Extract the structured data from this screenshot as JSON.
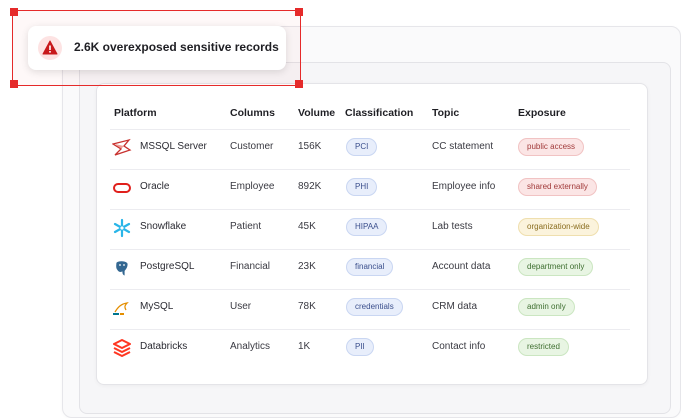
{
  "alert": {
    "message": "2.6K overexposed sensitive records",
    "icon": "warning-triangle-icon",
    "color": "#e52a2a"
  },
  "table": {
    "headers": [
      "Platform",
      "Columns",
      "Volume",
      "Classification",
      "Topic",
      "Exposure"
    ],
    "rows": [
      {
        "platform": "MSSQL Server",
        "logo": "mssql-server-logo-icon",
        "columns": "Customer",
        "volume": "156K",
        "classification": "PCI",
        "topic": "CC statement",
        "exposure": "public access",
        "exposure_level": "red"
      },
      {
        "platform": "Oracle",
        "logo": "oracle-logo-icon",
        "columns": "Employee",
        "volume": "892K",
        "classification": "PHI",
        "topic": "Employee info",
        "exposure": "shared externally",
        "exposure_level": "red"
      },
      {
        "platform": "Snowflake",
        "logo": "snowflake-logo-icon",
        "columns": "Patient",
        "volume": "45K",
        "classification": "HIPAA",
        "topic": "Lab tests",
        "exposure": "organization-wide",
        "exposure_level": "yellow"
      },
      {
        "platform": "PostgreSQL",
        "logo": "postgresql-logo-icon",
        "columns": "Financial",
        "volume": "23K",
        "classification": "financial",
        "topic": "Account data",
        "exposure": "department only",
        "exposure_level": "green"
      },
      {
        "platform": "MySQL",
        "logo": "mysql-logo-icon",
        "columns": "User",
        "volume": "78K",
        "classification": "credentials",
        "topic": "CRM data",
        "exposure": "admin only",
        "exposure_level": "green"
      },
      {
        "platform": "Databricks",
        "logo": "databricks-logo-icon",
        "columns": "Analytics",
        "volume": "1K",
        "classification": "PII",
        "topic": "Contact info",
        "exposure": "restricted",
        "exposure_level": "green"
      }
    ]
  },
  "colors": {
    "alert_red": "#e52a2a",
    "exposure_red": "#fbe5e5",
    "exposure_yellow": "#fbf3dc",
    "exposure_green": "#e8f5e3",
    "classification_blue": "#e8eefb"
  }
}
